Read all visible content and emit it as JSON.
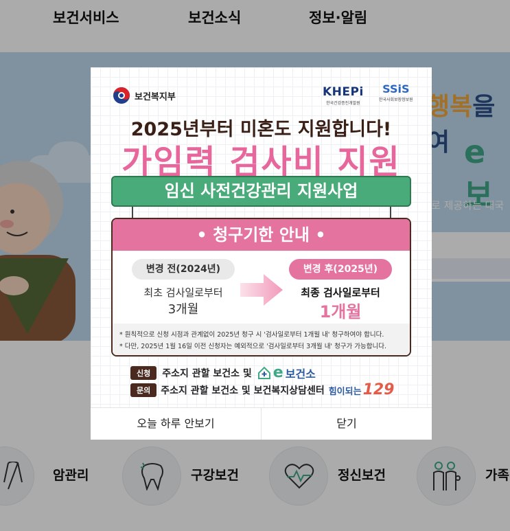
{
  "nav": {
    "items": [
      "보건서비스",
      "보건소식",
      "정보·알림"
    ]
  },
  "hero": {
    "headline_highlight": "행복",
    "headline_rest": "을 여",
    "e_title": "e보",
    "subtitle": "로 제공하는 대국"
  },
  "services": [
    {
      "label": "암관리",
      "icon": "cancer-ribbon-icon"
    },
    {
      "label": "구강보건",
      "icon": "tooth-icon"
    },
    {
      "label": "정신보건",
      "icon": "heart-pulse-icon"
    },
    {
      "label": "가족",
      "icon": "family-icon"
    }
  ],
  "popup": {
    "logos": {
      "mohw": "보건복지부",
      "khepi": "KHEPi",
      "khepi_sub": "한국건강증진개발원",
      "ssis": "SSiS",
      "ssis_sub": "한국사회보장정보원"
    },
    "headline_small": "2025년부터 미혼도 지원합니다!",
    "headline_big": "가임력 검사비 지원",
    "program": "임신 사전건강관리 지원사업",
    "section_title": "• 청구기한 안내 •",
    "before": {
      "label": "변경 전(2024년)",
      "line1": "최초 검사일로부터",
      "line2": "3개월"
    },
    "after": {
      "label": "변경 후(2025년)",
      "line1": "최종 검사일로부터",
      "line2": "1개월"
    },
    "notes": [
      "* 원칙적으로 신청 시점과 관계없이 2025년 청구 시 '검사일로부터 1개월 내' 청구하여야 합니다.",
      "* 다만, 2025년 1월 16일 이전 신청자는 예외적으로 '검사일로부터 3개월 내' 청구가 가능합니다."
    ],
    "apply": {
      "tag": "신청",
      "text": "주소지 관할 보건소 및",
      "brand_e": "e",
      "brand": "보건소"
    },
    "inquiry": {
      "tag": "문의",
      "text": "주소지 관할 보건소 및 보건복지상담센터",
      "brand_text": "힘이되는",
      "brand_num": "129"
    },
    "buttons": {
      "hide_today": "오늘 하루 안보기",
      "close": "닫기"
    }
  }
}
